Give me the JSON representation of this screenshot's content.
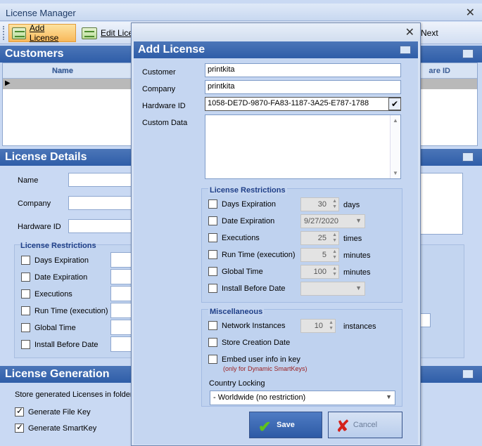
{
  "main_window": {
    "title": "License Manager",
    "toolbar": {
      "add_license": "Add License",
      "edit_license": "Edit Licen",
      "next": "Next"
    },
    "customers": {
      "header": "Customers",
      "columns": {
        "name": "Name",
        "hardware_id": "are ID"
      }
    },
    "license_details": {
      "header": "License Details",
      "labels": {
        "name": "Name",
        "company": "Company",
        "hardware_id": "Hardware ID"
      },
      "restrictions_title": "License Restrictions",
      "restrictions": [
        "Days Expiration",
        "Date Expiration",
        "Executions",
        "Run Time (execution)",
        "Global Time",
        "Install Before Date"
      ]
    },
    "license_generation": {
      "header": "License Generation",
      "store_label": "Store generated Licenses in folder:",
      "generate_file_key": "Generate File Key",
      "generate_smartkey": "Generate SmartKey",
      "generate_file_key_checked": true,
      "generate_smartkey_checked": true
    }
  },
  "dialog": {
    "title": "Add License",
    "fields": {
      "customer_label": "Customer",
      "customer_value": "printkita",
      "company_label": "Company",
      "company_value": "printkita",
      "hardware_id_label": "Hardware ID",
      "hardware_id_value": "1058-DE7D-9870-FA83-1187-3A25-E787-1788",
      "custom_data_label": "Custom Data"
    },
    "restrictions": {
      "title": "License Restrictions",
      "days_expiration": {
        "label": "Days Expiration",
        "value": "30",
        "unit": "days",
        "checked": false
      },
      "date_expiration": {
        "label": "Date Expiration",
        "value": "9/27/2020",
        "checked": false
      },
      "executions": {
        "label": "Executions",
        "value": "25",
        "unit": "times",
        "checked": false
      },
      "run_time": {
        "label": "Run Time (execution)",
        "value": "5",
        "unit": "minutes",
        "checked": false
      },
      "global_time": {
        "label": "Global Time",
        "value": "100",
        "unit": "minutes",
        "checked": false
      },
      "install_before": {
        "label": "Install Before Date",
        "value": "",
        "checked": false
      }
    },
    "misc": {
      "title": "Miscellaneous",
      "network_instances": {
        "label": "Network Instances",
        "value": "10",
        "unit": "instances",
        "checked": false
      },
      "store_creation_date": {
        "label": "Store Creation Date",
        "checked": false
      },
      "embed_user_info": {
        "label": "Embed user info in key",
        "note": "(only for Dynamic SmartKeys)",
        "checked": false
      },
      "country_locking_label": "Country Locking",
      "country_locking_value": "- Worldwide (no restriction)"
    },
    "buttons": {
      "save": "Save",
      "cancel": "Cancel"
    }
  },
  "colors": {
    "section_header": "#2f5ea8",
    "group_title": "#1f3f88",
    "note_red": "#9b1c1c",
    "save_check": "#5fc21b",
    "cancel_x": "#d4211b"
  },
  "icons": [
    "close-icon",
    "license-icon",
    "edit-license-icon",
    "checkmark-icon",
    "cancel-x-icon",
    "chevron-down-icon",
    "spin-arrows-icon"
  ]
}
